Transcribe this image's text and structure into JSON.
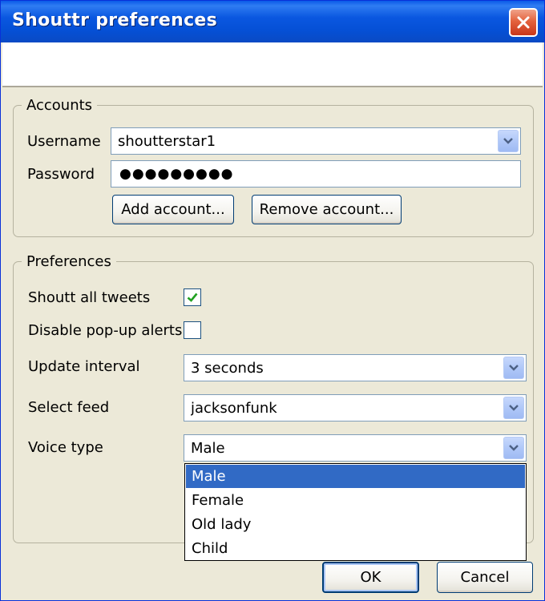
{
  "window": {
    "title": "Shouttr preferences",
    "close_icon": "close-icon"
  },
  "accounts": {
    "legend": "Accounts",
    "username_label": "Username",
    "username_value": "shoutterstar1",
    "password_label": "Password",
    "password_value": "●●●●●●●●●",
    "add_account_label": "Add account...",
    "remove_account_label": "Remove account..."
  },
  "preferences": {
    "legend": "Preferences",
    "shoutt_all_label": "Shoutt all tweets",
    "shoutt_all_checked": true,
    "disable_popups_label": "Disable pop-up alerts",
    "disable_popups_checked": false,
    "update_interval_label": "Update interval",
    "update_interval_value": "3 seconds",
    "select_feed_label": "Select feed",
    "select_feed_value": "jacksonfunk",
    "voice_type_label": "Voice type",
    "voice_type_value": "Male",
    "voice_options": [
      "Male",
      "Female",
      "Old lady",
      "Child"
    ],
    "voice_selected_index": 0
  },
  "footer": {
    "ok_label": "OK",
    "cancel_label": "Cancel"
  },
  "colors": {
    "titlebar": "#0a57e0",
    "dialog_bg": "#ece9d8",
    "selection": "#316ac5",
    "check": "#21a121"
  }
}
